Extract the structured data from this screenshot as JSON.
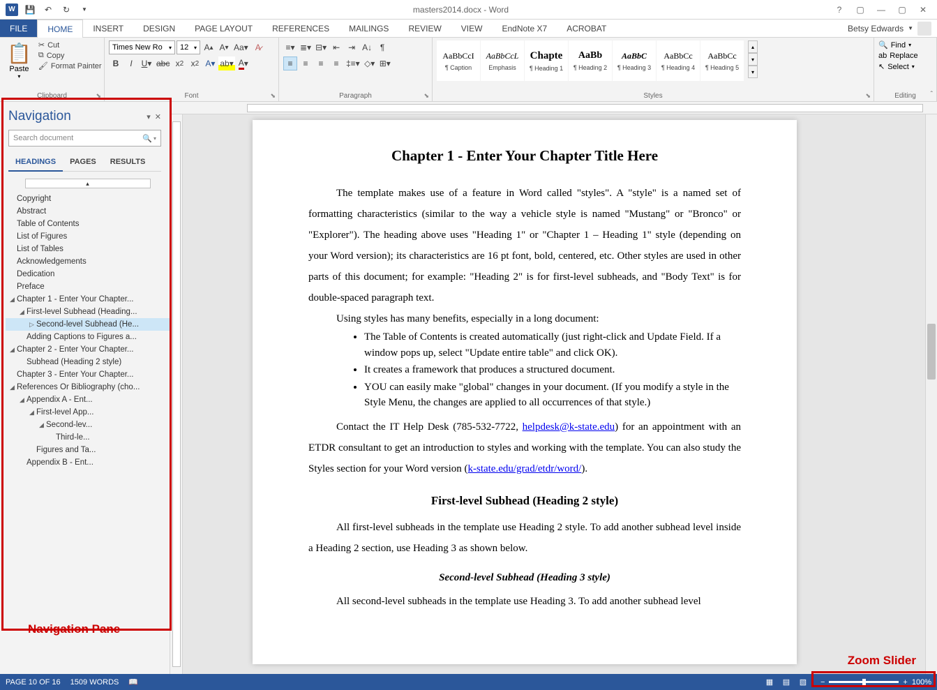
{
  "titleBar": {
    "docTitle": "masters2014.docx - Word",
    "user": "Betsy Edwards"
  },
  "tabs": [
    "FILE",
    "HOME",
    "INSERT",
    "DESIGN",
    "PAGE LAYOUT",
    "REFERENCES",
    "MAILINGS",
    "REVIEW",
    "VIEW",
    "EndNote X7",
    "ACROBAT"
  ],
  "ribbon": {
    "clipboard": {
      "paste": "Paste",
      "cut": "Cut",
      "copy": "Copy",
      "formatPainter": "Format Painter",
      "groupLabel": "Clipboard"
    },
    "font": {
      "name": "Times New Ro",
      "size": "12",
      "groupLabel": "Font"
    },
    "paragraph": {
      "groupLabel": "Paragraph"
    },
    "styles": {
      "groupLabel": "Styles",
      "items": [
        {
          "preview": "AaBbCcI",
          "label": "¶ Caption",
          "style": "font-size:12px"
        },
        {
          "preview": "AaBbCcL",
          "label": "Emphasis",
          "style": "font-style:italic;font-size:12px"
        },
        {
          "preview": "Chapte",
          "label": "¶ Heading 1",
          "style": "font-weight:bold;font-size:15px"
        },
        {
          "preview": "AaBb",
          "label": "¶ Heading 2",
          "style": "font-weight:bold;font-size:14px"
        },
        {
          "preview": "AaBbC",
          "label": "¶ Heading 3",
          "style": "font-style:italic;font-weight:bold;font-size:12px"
        },
        {
          "preview": "AaBbCc",
          "label": "¶ Heading 4",
          "style": "font-size:12px"
        },
        {
          "preview": "AaBbCc",
          "label": "¶ Heading 5",
          "style": "font-size:12px"
        }
      ]
    },
    "editing": {
      "find": "Find",
      "replace": "Replace",
      "select": "Select",
      "groupLabel": "Editing"
    }
  },
  "navPane": {
    "title": "Navigation",
    "searchPlaceholder": "Search document",
    "tabs": [
      "HEADINGS",
      "PAGES",
      "RESULTS"
    ],
    "tree": [
      {
        "l": 0,
        "t": "Copyright"
      },
      {
        "l": 0,
        "t": "Abstract"
      },
      {
        "l": 0,
        "t": "Table of Contents"
      },
      {
        "l": 0,
        "t": "List of Figures"
      },
      {
        "l": 0,
        "t": "List of Tables"
      },
      {
        "l": 0,
        "t": "Acknowledgements"
      },
      {
        "l": 0,
        "t": "Dedication"
      },
      {
        "l": 0,
        "t": "Preface"
      },
      {
        "l": 0,
        "t": "Chapter 1 -  Enter Your Chapter...",
        "exp": true
      },
      {
        "l": 1,
        "t": "First-level Subhead (Heading...",
        "exp": true
      },
      {
        "l": 2,
        "t": "Second-level Subhead (He...",
        "sel": true,
        "caret": true
      },
      {
        "l": 1,
        "t": "Adding Captions to Figures a..."
      },
      {
        "l": 0,
        "t": "Chapter 2 -  Enter Your Chapter...",
        "exp": true
      },
      {
        "l": 1,
        "t": "Subhead (Heading 2 style)"
      },
      {
        "l": 0,
        "t": "Chapter 3 -  Enter Your Chapter..."
      },
      {
        "l": 0,
        "t": "References Or Bibliography (cho...",
        "exp": true
      },
      {
        "l": 1,
        "t": "Appendix A -  Ent...",
        "exp": true
      },
      {
        "l": 2,
        "t": "First-level App...",
        "exp": true
      },
      {
        "l": 3,
        "t": "Second-lev...",
        "exp": true
      },
      {
        "l": 4,
        "t": "Third-le..."
      },
      {
        "l": 2,
        "t": "Figures and Ta..."
      },
      {
        "l": 1,
        "t": "Appendix B -  Ent..."
      }
    ],
    "annotation": "Navigation Pane"
  },
  "document": {
    "h1": "Chapter 1 - Enter Your Chapter Title Here",
    "p1": "The template makes use of a feature in Word called \"styles\".  A \"style\" is a named set of formatting characteristics (similar to the way a vehicle style is named \"Mustang\" or \"Bronco\" or \"Explorer\").  The heading above uses \"Heading 1\" or \"Chapter 1 – Heading 1\" style (depending on your Word version); its characteristics are 16 pt font, bold, centered, etc.   Other styles are used in other parts of this document; for example: \"Heading 2\" is for first-level subheads, and \"Body Text\" is for double-spaced paragraph text.",
    "p2": "Using styles has many benefits, especially in a long document:",
    "bullets": [
      "The Table of Contents is created automatically (just right-click and Update Field. If a window pops up, select \"Update entire table\" and click OK).",
      "It creates a framework that produces a structured document.",
      "YOU can easily make \"global\" changes in your document.  (If you modify a style in the Style Menu, the changes are applied to all occurrences of that style.)"
    ],
    "p3a": "Contact the IT Help Desk (785-532-7722, ",
    "link1": "helpdesk@k-state.edu",
    "p3b": ") for an appointment with an ETDR consultant to get an introduction to styles and working with the template.  You can also study the Styles section for your Word version (",
    "link2": "k-state.edu/grad/etdr/word/",
    "p3c": ").",
    "h2": "First-level Subhead (Heading 2 style)",
    "p4": "All first-level subheads in the template use Heading 2 style.  To add another subhead level inside a Heading 2 section, use Heading 3 as shown below.",
    "h3": "Second-level Subhead (Heading 3 style)",
    "p5": "All second-level subheads in the template use Heading 3.  To add another subhead level"
  },
  "statusBar": {
    "page": "PAGE 10 OF 16",
    "words": "1509 WORDS",
    "zoom": "100%"
  },
  "zoomAnnotation": "Zoom Slider"
}
